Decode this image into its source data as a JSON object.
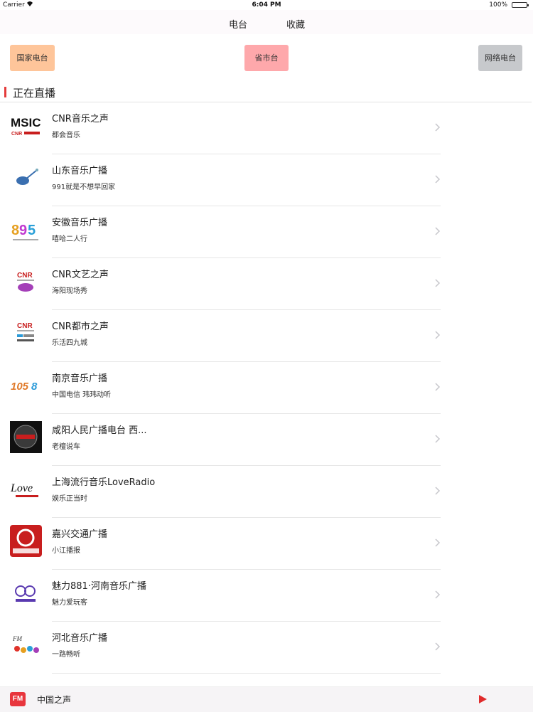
{
  "status": {
    "carrier": "Carrier",
    "time": "6:04 PM",
    "battery": "100%"
  },
  "nav": {
    "tabs": [
      "电台",
      "收藏"
    ]
  },
  "categories": [
    "国家电台",
    "省市台",
    "网络电台"
  ],
  "section": {
    "title": "正在直播"
  },
  "stations": [
    {
      "name": "CNR音乐之声",
      "program": "都会音乐",
      "logo": "music-radio-logo-icon"
    },
    {
      "name": "山东音乐广播",
      "program": "991就是不想早回家",
      "logo": "guitar-logo-icon"
    },
    {
      "name": "安徽音乐广播",
      "program": "嘻哈二人行",
      "logo": "895-logo-icon"
    },
    {
      "name": "CNR文艺之声",
      "program": "海阳现场秀",
      "logo": "cnr-wenyi-logo-icon"
    },
    {
      "name": "CNR都市之声",
      "program": "乐活四九城",
      "logo": "cnr-dushi-logo-icon"
    },
    {
      "name": "南京音乐广播",
      "program": "中国电信 玮玮动听",
      "logo": "1058-logo-icon"
    },
    {
      "name": "咸阳人民广播电台 西...",
      "program": "老檀说车",
      "logo": "dark-circle-logo-icon"
    },
    {
      "name": "上海流行音乐LoveRadio",
      "program": "娱乐正当时",
      "logo": "love-radio-logo-icon"
    },
    {
      "name": "嘉兴交通广播",
      "program": "小江播报",
      "logo": "fm922-logo-icon"
    },
    {
      "name": "魅力881·河南音乐广播",
      "program": "魅力爱玩客",
      "logo": "881-logo-icon"
    },
    {
      "name": "河北音乐广播",
      "program": "一路畅听",
      "logo": "hebei-logo-icon"
    },
    {
      "name": "",
      "program": "",
      "logo": ""
    }
  ],
  "player": {
    "logo_text": "FM",
    "now_playing": "中国之声"
  },
  "colors": {
    "accent": "#e43b3b",
    "cat1": "#fec59a",
    "cat2": "#fea8ab",
    "cat3": "#c7c9cc"
  }
}
